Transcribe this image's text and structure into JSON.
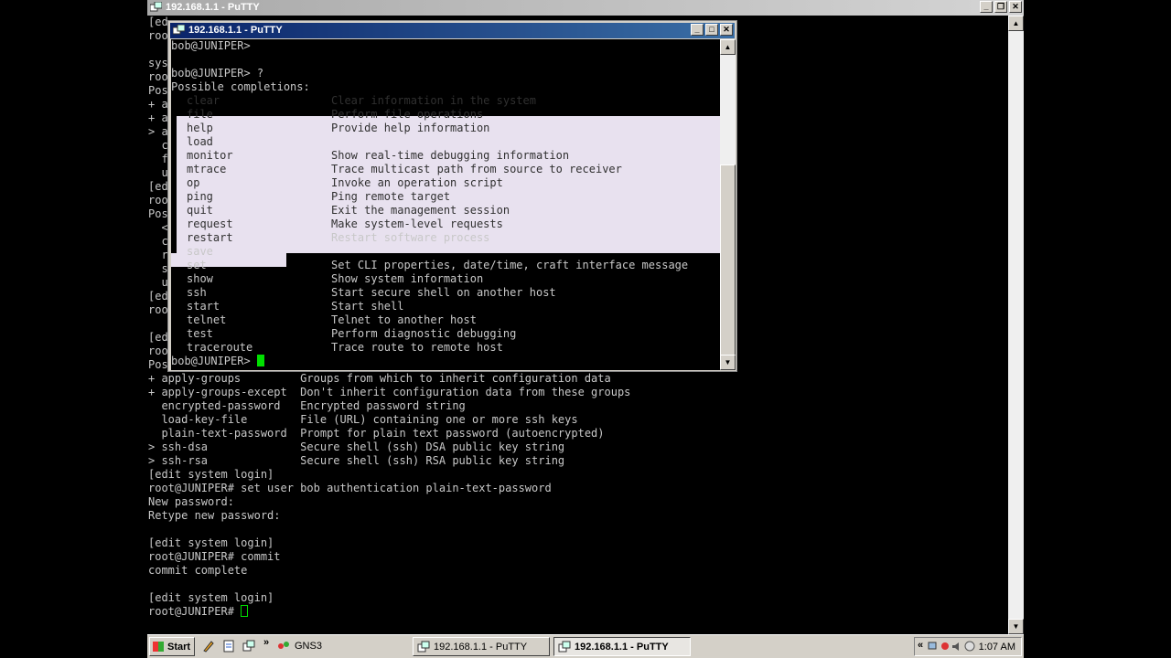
{
  "outer_window": {
    "title": "192.168.1.1 - PuTTY",
    "terminal_visible": [
      "[ed",
      "roo",
      "",
      "sys",
      "roo",
      "Pos",
      "+ a",
      "+ a",
      "> a",
      "  c",
      "  f",
      "  u",
      "[ed",
      "roo",
      "Pos",
      "  <",
      "  c",
      "  r",
      "  s",
      "  u",
      "[ed",
      "roo",
      "",
      "[ed",
      "roo",
      "Pos",
      "+ apply-groups         Groups from which to inherit configuration data",
      "+ apply-groups-except  Don't inherit configuration data from these groups",
      "  encrypted-password   Encrypted password string",
      "  load-key-file        File (URL) containing one or more ssh keys",
      "  plain-text-password  Prompt for plain text password (autoencrypted)",
      "> ssh-dsa              Secure shell (ssh) DSA public key string",
      "> ssh-rsa              Secure shell (ssh) RSA public key string",
      "[edit system login]",
      "root@JUNIPER# set user bob authentication plain-text-password",
      "New password:",
      "Retype new password:",
      "",
      "[edit system login]",
      "root@JUNIPER# commit",
      "commit complete",
      "",
      "[edit system login]",
      "root@JUNIPER# "
    ]
  },
  "inner_window": {
    "title": "192.168.1.1 - PuTTY",
    "prompt_lines": [
      "bob@JUNIPER>",
      "",
      "bob@JUNIPER> ?",
      "Possible completions:"
    ],
    "completions": [
      {
        "cmd": "clear",
        "desc": "Clear information in the system"
      },
      {
        "cmd": "file",
        "desc": "Perform file operations"
      },
      {
        "cmd": "help",
        "desc": "Provide help information"
      },
      {
        "cmd": "load",
        "desc": ""
      },
      {
        "cmd": "monitor",
        "desc": "Show real-time debugging information"
      },
      {
        "cmd": "mtrace",
        "desc": "Trace multicast path from source to receiver"
      },
      {
        "cmd": "op",
        "desc": "Invoke an operation script"
      },
      {
        "cmd": "ping",
        "desc": "Ping remote target"
      },
      {
        "cmd": "quit",
        "desc": "Exit the management session"
      },
      {
        "cmd": "request",
        "desc": "Make system-level requests"
      },
      {
        "cmd": "restart",
        "desc": "Restart software process"
      },
      {
        "cmd": "save",
        "desc": ""
      },
      {
        "cmd": "set",
        "desc": "Set CLI properties, date/time, craft interface message"
      },
      {
        "cmd": "show",
        "desc": "Show system information"
      },
      {
        "cmd": "ssh",
        "desc": "Start secure shell on another host"
      },
      {
        "cmd": "start",
        "desc": "Start shell"
      },
      {
        "cmd": "telnet",
        "desc": "Telnet to another host"
      },
      {
        "cmd": "test",
        "desc": "Perform diagnostic debugging"
      },
      {
        "cmd": "traceroute",
        "desc": "Trace route to remote host"
      }
    ],
    "final_prompt": "bob@JUNIPER> "
  },
  "taskbar": {
    "start_label": "Start",
    "gns3_label": "GNS3",
    "task1_label": "192.168.1.1 - PuTTY",
    "task2_label": "192.168.1.1 - PuTTY",
    "overflow": "»",
    "tray_overflow": "«",
    "clock": "1:07 AM"
  },
  "colors": {
    "cursor": "#00e000",
    "selection": "#e8e1ef",
    "active_title": "#0a246a",
    "inactive_title": "#a9a9a9"
  }
}
